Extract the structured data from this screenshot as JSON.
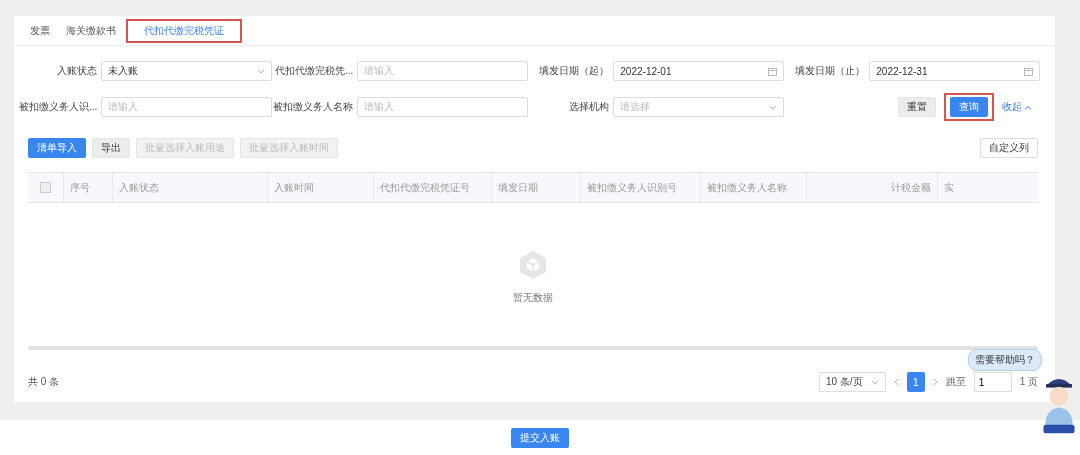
{
  "tabs": [
    {
      "label": "发票",
      "selected": false,
      "highlighted": false
    },
    {
      "label": "海关缴款书",
      "selected": false,
      "highlighted": false
    },
    {
      "label": "代扣代缴完税凭证",
      "selected": true,
      "highlighted": true
    }
  ],
  "filters": [
    {
      "label": "入账状态",
      "kind": "select",
      "value": "未入账"
    },
    {
      "label": "代扣代缴完税凭...",
      "kind": "input",
      "placeholder": "请输入"
    },
    {
      "label": "填发日期（起）",
      "kind": "date",
      "value": "2022-12-01"
    },
    {
      "label": "填发日期（止）",
      "kind": "date",
      "value": "2022-12-31"
    },
    {
      "label": "被扣缴义务人识...",
      "kind": "input",
      "placeholder": "请输入"
    },
    {
      "label": "被扣缴义务人名称",
      "kind": "input",
      "placeholder": "请输入"
    },
    {
      "label": "选择机构",
      "kind": "select",
      "placeholder": "请选择"
    }
  ],
  "filter_actions": {
    "reset": "重置",
    "query": {
      "label": "查询",
      "highlighted": true
    },
    "collapse": "收起"
  },
  "toolbar": [
    {
      "label": "清单导入",
      "kind": "primary",
      "disabled": false
    },
    {
      "label": "导出",
      "kind": "default",
      "disabled": false
    },
    {
      "label": "批量选择入账用途",
      "kind": "default",
      "disabled": true
    },
    {
      "label": "批量选择入账时间",
      "kind": "default",
      "disabled": true
    }
  ],
  "custom_columns": "自定义列",
  "table": {
    "select_all_checked": false,
    "columns": [
      "序号",
      "入账状态",
      "入账时间",
      "代扣代缴完税凭证号",
      "填发日期",
      "被扣缴义务人识别号",
      "被扣缴义务人名称",
      "计税金额",
      "实"
    ],
    "empty_text": "暂无数据"
  },
  "total": "共 0 条",
  "pagination": {
    "page_size": "10 条/页",
    "pages": [
      {
        "label": "1",
        "selected": true
      }
    ],
    "jump_label": "跳至",
    "jump_value": "1",
    "page_count": "1 页"
  },
  "submit": "提交入账",
  "assistant": {
    "bubble": "需要帮助吗？"
  }
}
